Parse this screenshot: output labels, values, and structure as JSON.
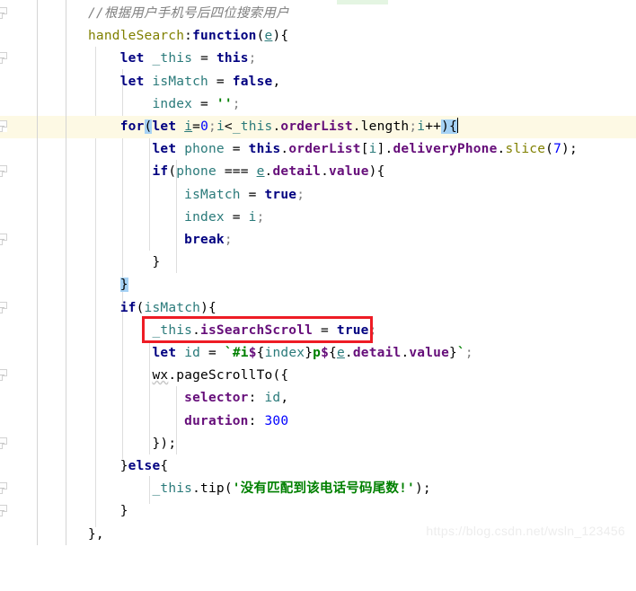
{
  "editor": {
    "watermark": "https://blog.csdn.net/wsln_123456",
    "colors": {
      "background": "#ffffff",
      "current_line_highlight": "#fdf9e4",
      "bracket_match_highlight": "#a6d2f5",
      "annotation_box": "#ee1c25",
      "keyword": "#000080",
      "property": "#660e7a",
      "string": "#008000",
      "number": "#0000ff",
      "comment": "#808080",
      "local_variable": "#2a7a7a",
      "function_key": "#808000",
      "watermark_text": "#ededed",
      "top_marker": "#e4f5e2",
      "gutter_rule": "#d4d4d4",
      "indent_guide": "#dedede"
    }
  },
  "annotation": {
    "label": "red-highlight-box",
    "target_line_index": 14
  },
  "lines": [
    {
      "n": 1,
      "indent": 0,
      "fold": false,
      "current": false,
      "text": "//根据用户手机号后四位搜索用户"
    },
    {
      "n": 2,
      "indent": 0,
      "fold": true,
      "current": false,
      "text": "handleSearch:function(e){"
    },
    {
      "n": 3,
      "indent": 1,
      "fold": false,
      "current": false,
      "text": "let _this = this;"
    },
    {
      "n": 4,
      "indent": 1,
      "fold": false,
      "current": false,
      "text": "let isMatch = false,"
    },
    {
      "n": 5,
      "indent": 2,
      "fold": false,
      "current": false,
      "text": "index = '';"
    },
    {
      "n": 6,
      "indent": 1,
      "fold": true,
      "current": true,
      "text": "for(let i=0;i<_this.orderList.length;i++){"
    },
    {
      "n": 7,
      "indent": 2,
      "fold": false,
      "current": false,
      "text": "let phone = this.orderList[i].deliveryPhone.slice(7);"
    },
    {
      "n": 8,
      "indent": 2,
      "fold": true,
      "current": false,
      "text": "if(phone === e.detail.value){"
    },
    {
      "n": 9,
      "indent": 3,
      "fold": false,
      "current": false,
      "text": "isMatch = true;"
    },
    {
      "n": 10,
      "indent": 3,
      "fold": false,
      "current": false,
      "text": "index = i;"
    },
    {
      "n": 11,
      "indent": 3,
      "fold": false,
      "current": false,
      "text": "break;"
    },
    {
      "n": 12,
      "indent": 2,
      "fold": false,
      "current": false,
      "text": "}"
    },
    {
      "n": 13,
      "indent": 1,
      "fold": false,
      "current": false,
      "text": "}"
    },
    {
      "n": 14,
      "indent": 1,
      "fold": true,
      "current": false,
      "text": "if(isMatch){"
    },
    {
      "n": 15,
      "indent": 2,
      "fold": false,
      "current": false,
      "text": "_this.isSearchScroll = true;"
    },
    {
      "n": 16,
      "indent": 2,
      "fold": false,
      "current": false,
      "text": "let id = `#i${index}p${e.detail.value}`;"
    },
    {
      "n": 17,
      "indent": 2,
      "fold": true,
      "current": false,
      "text": "wx.pageScrollTo({"
    },
    {
      "n": 18,
      "indent": 3,
      "fold": false,
      "current": false,
      "text": "selector: id,"
    },
    {
      "n": 19,
      "indent": 3,
      "fold": false,
      "current": false,
      "text": "duration: 300"
    },
    {
      "n": 20,
      "indent": 2,
      "fold": false,
      "current": false,
      "text": "});"
    },
    {
      "n": 21,
      "indent": 1,
      "fold": true,
      "current": false,
      "text": "}else{"
    },
    {
      "n": 22,
      "indent": 2,
      "fold": false,
      "current": false,
      "text": "_this.tip('没有匹配到该电话号码尾数!');"
    },
    {
      "n": 23,
      "indent": 1,
      "fold": false,
      "current": false,
      "text": "}"
    },
    {
      "n": 24,
      "indent": 0,
      "fold": false,
      "current": false,
      "text": "},"
    }
  ],
  "tokens": {
    "comment_1": "//根据用户手机号后四位搜索用户",
    "key_handleSearch": "handleSearch",
    "kw_function": "function",
    "param_e": "e",
    "kw_let": "let",
    "kw_this": "this",
    "kw_for": "for",
    "kw_if": "if",
    "kw_else": "else",
    "kw_break": "break",
    "kw_true": "true",
    "kw_false": "false",
    "var__this": "_this",
    "var_isMatch": "isMatch",
    "var_index": "index",
    "var_phone": "phone",
    "var_i": "i",
    "var_id": "id",
    "prop_orderList": "orderList",
    "prop_length": "length",
    "prop_deliveryPhone": "deliveryPhone",
    "prop_slice": "slice",
    "prop_detail": "detail",
    "prop_value": "value",
    "prop_isSearchScroll": "isSearchScroll",
    "prop_tip": "tip",
    "glob_wx": "wx",
    "prop_pageScrollTo": "pageScrollTo",
    "prop_selector": "selector",
    "prop_duration": "duration",
    "num_0": "0",
    "num_7": "7",
    "num_300": "300",
    "str_empty": "''",
    "str_tip": "'没有匹配到该电话号码尾数!'",
    "tpl_id": "`#i${index}p${e.detail.value}`",
    "tpl_hash_i": "#i",
    "tpl_p": "p"
  }
}
